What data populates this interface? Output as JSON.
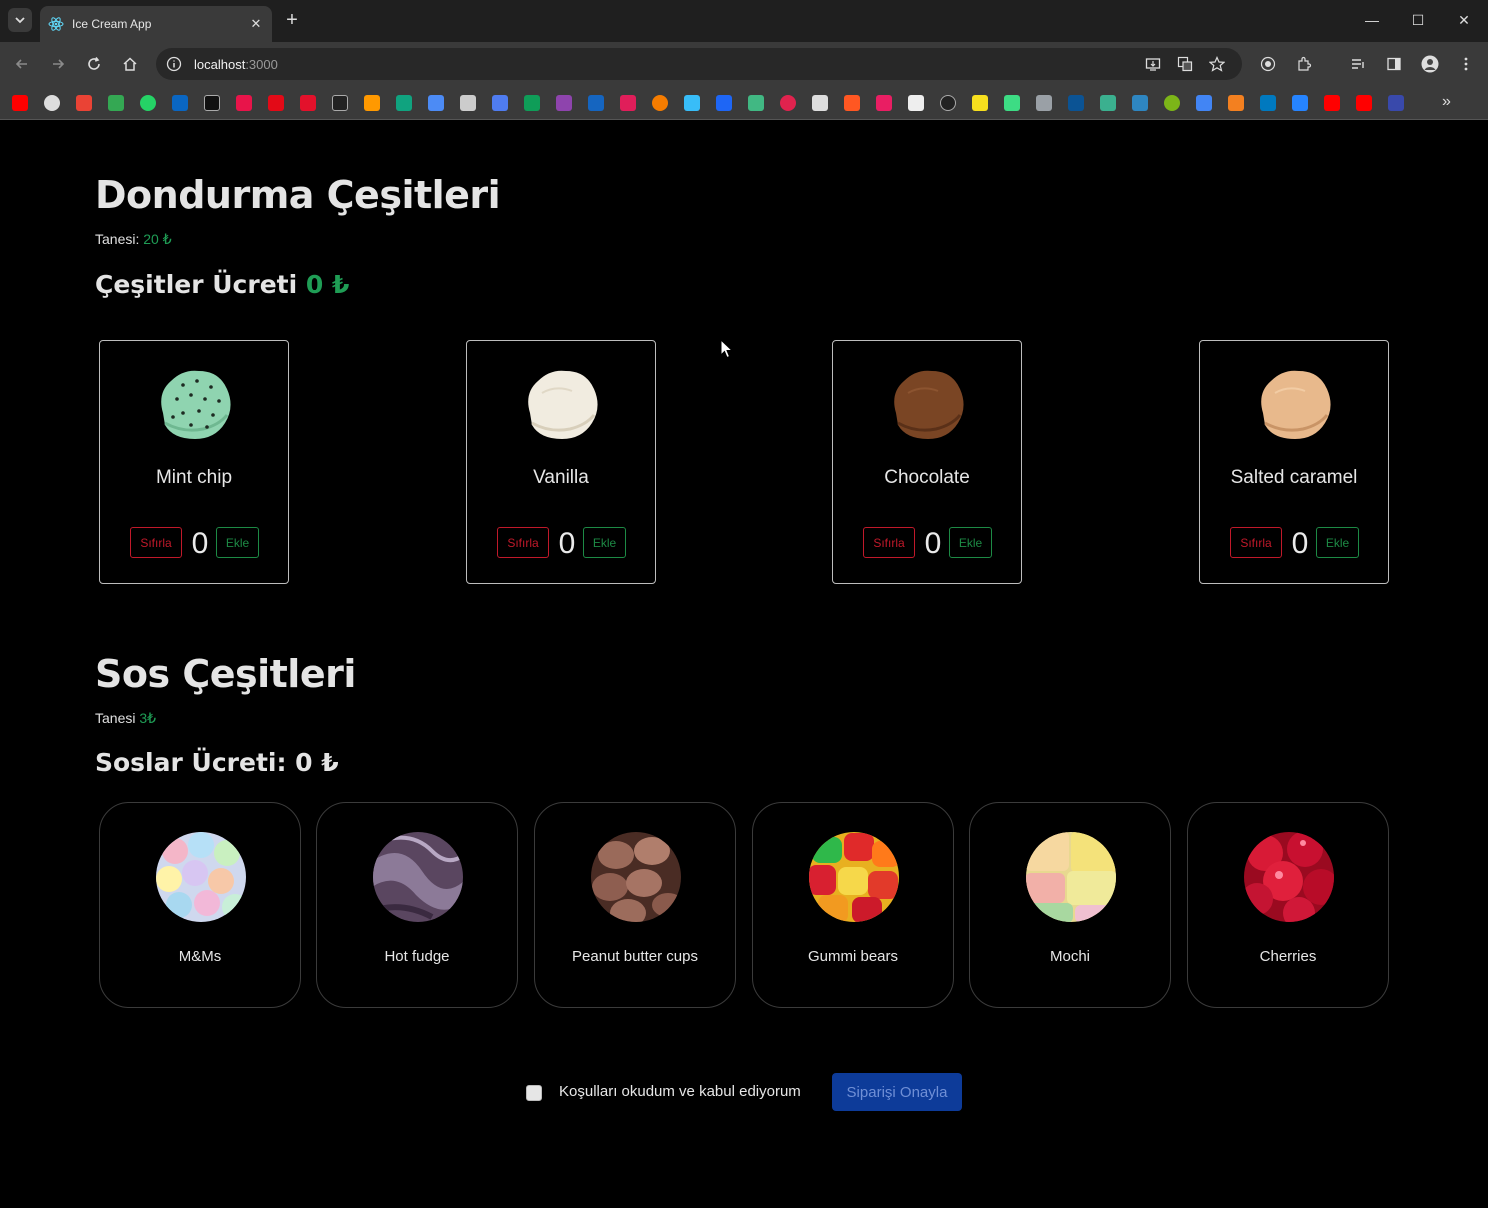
{
  "browser": {
    "tab_title": "Ice Cream App",
    "url_host": "localhost",
    "url_port": ":3000"
  },
  "scoops_section": {
    "title": "Dondurma Çeşitleri",
    "unit_label": "Tanesi: ",
    "unit_price": "20 ₺",
    "total_label": "Çeşitler Ücreti ",
    "total_value": "0 ₺",
    "items": [
      {
        "name": "Mint chip",
        "count": "0",
        "reset_label": "Sıfırla",
        "add_label": "Ekle",
        "color": "#8fd4b0"
      },
      {
        "name": "Vanilla",
        "count": "0",
        "reset_label": "Sıfırla",
        "add_label": "Ekle",
        "color": "#f1ece0"
      },
      {
        "name": "Chocolate",
        "count": "0",
        "reset_label": "Sıfırla",
        "add_label": "Ekle",
        "color": "#7a4524"
      },
      {
        "name": "Salted caramel",
        "count": "0",
        "reset_label": "Sıfırla",
        "add_label": "Ekle",
        "color": "#e8b98c"
      }
    ]
  },
  "toppings_section": {
    "title": "Sos Çeşitleri",
    "unit_label": "Tanesi ",
    "unit_price": "3₺",
    "total_label": "Soslar Ücreti: 0 ₺",
    "items": [
      {
        "name": "M&Ms",
        "color": "#b9c8e6"
      },
      {
        "name": "Hot fudge",
        "color": "#6d5a73"
      },
      {
        "name": "Peanut butter cups",
        "color": "#8a5a4c"
      },
      {
        "name": "Gummi bears",
        "color": "#d93a2a"
      },
      {
        "name": "Mochi",
        "color": "#e8d37e"
      },
      {
        "name": "Cherries",
        "color": "#c8102e"
      }
    ]
  },
  "order": {
    "terms_label": "Koşulları okudum ve kabul ediyorum",
    "confirm_label": "Siparişi Onayla"
  },
  "colors": {
    "accent_green": "#1f9d55",
    "reset_red": "#c0192a",
    "confirm_blue": "#0d3b99"
  }
}
